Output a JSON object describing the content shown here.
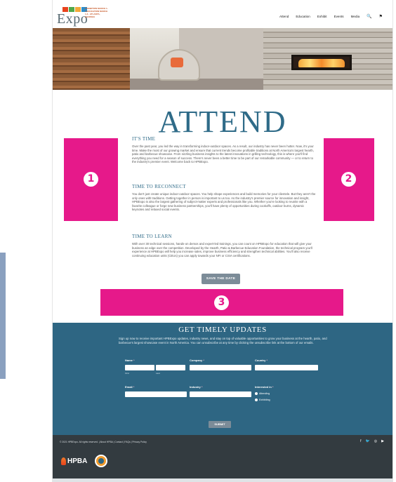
{
  "header": {
    "logo_text": "Expo",
    "logo_tagline": "EXHIBITION MARCH 1-3 EDUCATION MARCH 1-3 · ATLANTA, GEORGIA",
    "nav": [
      "Attend",
      "Education",
      "Exhibit",
      "Events",
      "Media"
    ],
    "search_icon": "🔍",
    "flag_icon": "⚑"
  },
  "page": {
    "title": "ATTEND"
  },
  "sections": [
    {
      "heading": "IT'S TIME",
      "body": "Over the past year, you led the way in transforming indoor-outdoor spaces. As a result, our industry has never been hotter. Now, it's your time. Make the most of our growing market and ensure that current trends become profitable traditions at North America's largest hearth, patio and barbecue showcase. From sizzling business insights to the latest innovations in grilling technology, this is where you'll find everything you need for a season of success. There's never been a better time to be part of our remarkable community — or to return to the industry's premier event. Welcome back to HPBExpo."
    },
    {
      "heading": "TIME TO RECONNECT",
      "body": "You don't just create unique indoor-outdoor spaces. You help shape experiences and build memories for your clientele. But they aren't the only ones with traditions. Getting together in person is important to us too. As the industry's premier source for innovation and insight, HPBExpo is also the largest gathering of subject-matter experts and professionals like you. Whether you're looking to reunite with a favorite colleague or forge new business partnerships, you'll have plenty of opportunities during cookoffs, outdoor burns, dynamic keynotes and relaxed social events."
    },
    {
      "heading": "TIME TO LEARN",
      "body": "With over 30 technical sessions, hands-on demos and expert-led trainings, you can count on HPBExpo for education that will give your business an edge over the competition. Developed by the Hearth, Patio & Barbecue Education Foundation, the technical program you'll experience at HPBExpo will help you increase sales, improve business efficiency and strengthen technical abilities. You'll also receive continuing education units (CEUs) you can apply towards your NFI or CSIA certifications."
    }
  ],
  "markers": [
    "1",
    "2",
    "3"
  ],
  "save_button": "SAVE THE DATE",
  "updates": {
    "title": "GET TIMELY UPDATES",
    "description": "Sign up now to receive important HPBExpo updates, industry news, and stay on top of valuable opportunities to grow your business at the hearth, patio, and barbecue's largest showcase event in North America. You can unsubscribe at any time by clicking the unsubscribe link at the bottom of our emails.",
    "name_label": "Name",
    "first_sub": "First",
    "last_sub": "Last",
    "company_label": "Company",
    "country_label": "Country",
    "email_label": "Email",
    "industry_label": "Industry",
    "interested_label": "Interested in",
    "required_mark": "*",
    "radio_options": [
      "Attending",
      "Exhibiting"
    ],
    "submit": "SUBMIT"
  },
  "footer": {
    "copyright": "© 2021 HPBExpo. All rights reserved. | About HPBA | Contact | FAQs | Privacy Policy",
    "social": [
      "f",
      "🐦",
      "◎",
      "▶"
    ],
    "hpba_logo": "HPBA"
  },
  "colors": {
    "accent": "#2f6b88",
    "marker": "#e6198a",
    "updates_bg": "#2e6683",
    "footer_bg": "#333b40",
    "button": "#7c8c98"
  }
}
